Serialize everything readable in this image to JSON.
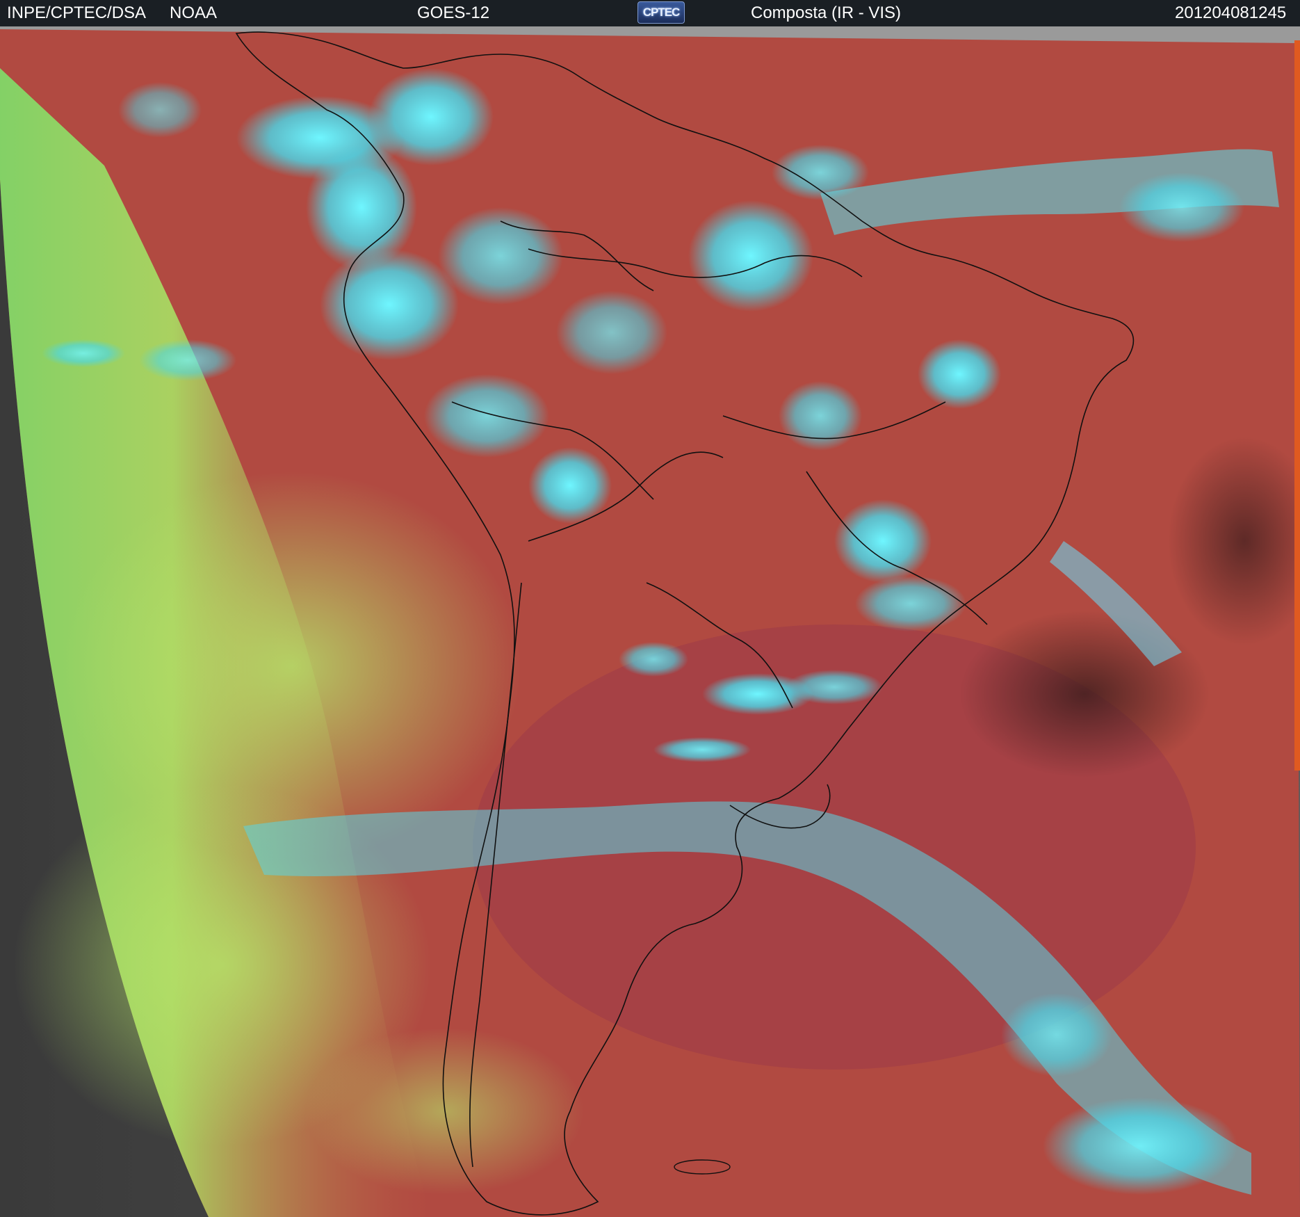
{
  "header": {
    "left_agency": "INPE/CPTEC/DSA",
    "source": "NOAA",
    "satellite": "GOES-12",
    "logo_text": "CPTEC",
    "product": "Composta (IR - VIS)",
    "timestamp": "201204081245"
  },
  "colors": {
    "header_bg": "#1a1f24",
    "land_red": "#b04a40",
    "ocean_red": "#a84240",
    "cloud_cyan": "#40e8f0",
    "low_cloud_green": "#a6e060",
    "night_gray": "#4a4a4a",
    "border_line": "#101010"
  }
}
